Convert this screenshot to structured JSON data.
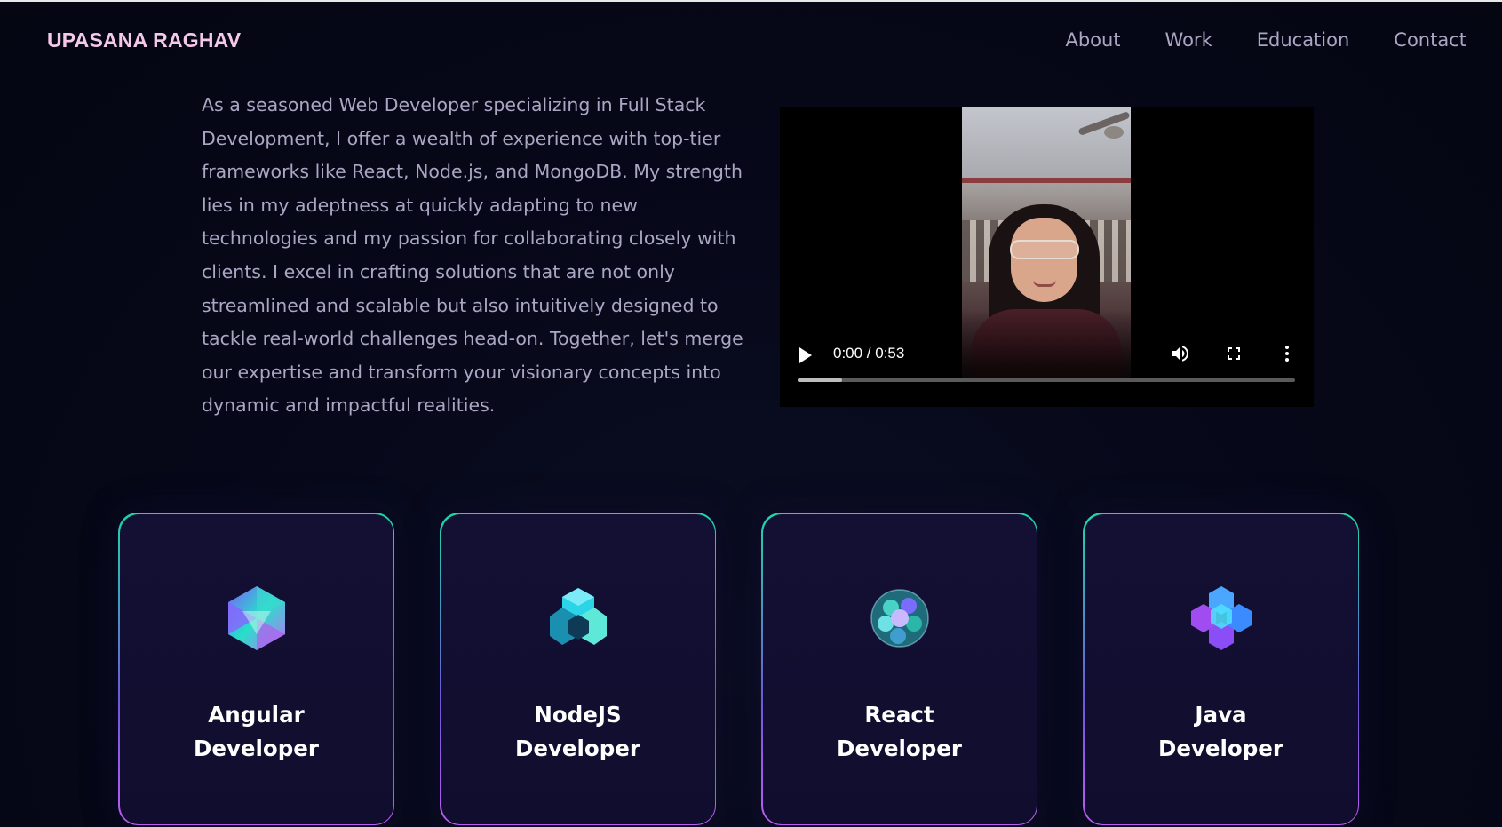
{
  "nav": {
    "brand": "UPASANA RAGHAV",
    "links": [
      "About",
      "Work",
      "Education",
      "Contact"
    ]
  },
  "about": {
    "bio": "As a seasoned Web Developer specializing in Full Stack Development, I offer a wealth of experience with top-tier frameworks like React, Node.js, and MongoDB. My strength lies in my adeptness at quickly adapting to new technologies and my passion for collaborating closely with clients. I excel in crafting solutions that are not only streamlined and scalable but also intuitively designed to tackle real-world challenges head-on. Together, let's merge our expertise and transform your visionary concepts into dynamic and impactful realities."
  },
  "video": {
    "time": "0:00 / 0:53",
    "progress": 0.09,
    "icons": [
      "play-icon",
      "volume-icon",
      "fullscreen-icon",
      "more-options-icon"
    ]
  },
  "services": [
    {
      "title_line1": "Angular",
      "title_line2": "Developer",
      "icon": "icosahedron-icon"
    },
    {
      "title_line1": "NodeJS",
      "title_line2": "Developer",
      "icon": "cube-cluster-icon"
    },
    {
      "title_line1": "React",
      "title_line2": "Developer",
      "icon": "sphere-cluster-icon"
    },
    {
      "title_line1": "Java",
      "title_line2": "Developer",
      "icon": "hexagon-cluster-icon"
    }
  ],
  "colors": {
    "background": "#050816",
    "brand": "#f4c9e8",
    "text_secondary": "#aaa6c3",
    "card_bg": "#141034",
    "card_border_top": "#1fd6a8",
    "card_border_bottom": "#bd5cf5"
  }
}
